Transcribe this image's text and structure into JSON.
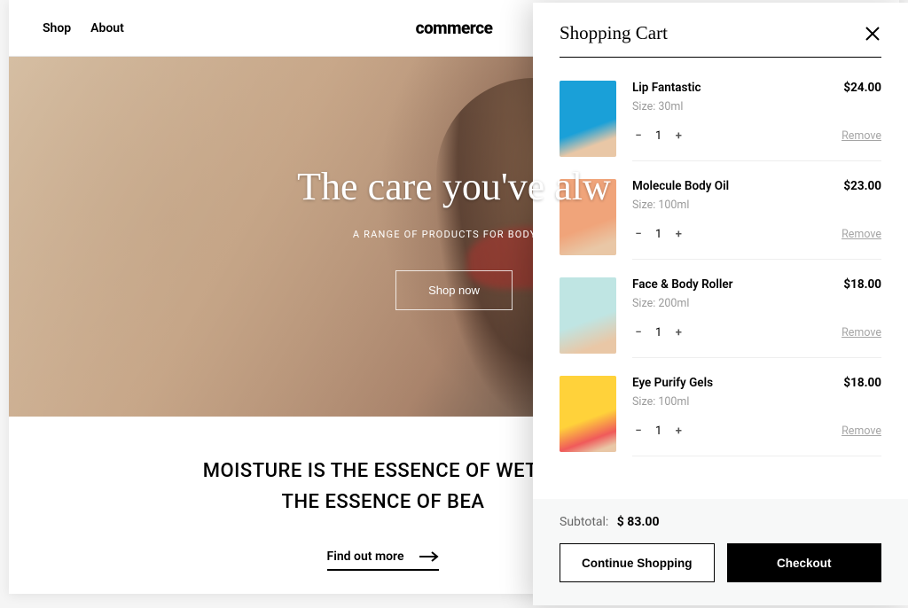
{
  "nav": {
    "shop": "Shop",
    "about": "About"
  },
  "logo": "commerce",
  "hero": {
    "title": "The care you've alw",
    "subtitle": "A RANGE OF PRODUCTS FOR BODY CA",
    "cta": "Shop now"
  },
  "essence": {
    "line1": "MOISTURE IS THE ESSENCE OF WETNE",
    "line2": "THE ESSENCE OF BEA",
    "findout": "Find out more"
  },
  "cart": {
    "title": "Shopping Cart",
    "items": [
      {
        "name": "Lip Fantastic",
        "size": "Size: 30ml",
        "price": "$24.00",
        "qty": "1",
        "img": "pi-blue"
      },
      {
        "name": "Molecule Body Oil",
        "size": "Size: 100ml",
        "price": "$23.00",
        "qty": "1",
        "img": "pi-peach"
      },
      {
        "name": "Face & Body Roller",
        "size": "Size: 200ml",
        "price": "$18.00",
        "qty": "1",
        "img": "pi-teal"
      },
      {
        "name": "Eye Purify Gels",
        "size": "Size: 100ml",
        "price": "$18.00",
        "qty": "1",
        "img": "pi-yellow"
      }
    ],
    "remove_label": "Remove",
    "subtotal_label": "Subtotal:",
    "subtotal_value": "$ 83.00",
    "continue_label": "Continue Shopping",
    "checkout_label": "Checkout"
  }
}
